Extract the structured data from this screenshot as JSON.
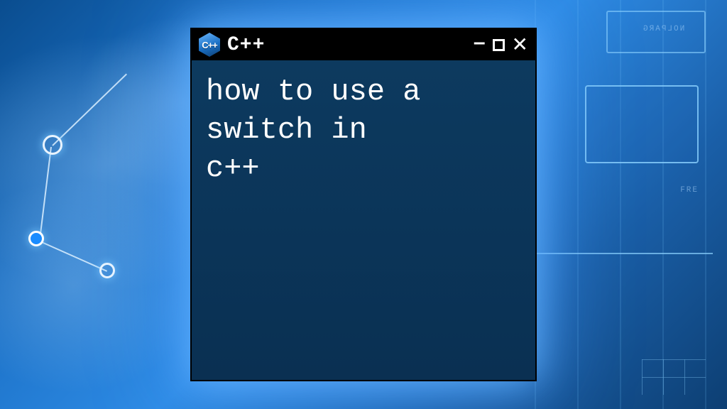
{
  "window": {
    "title": "C++",
    "icon_label": "C++",
    "icon_name": "cpp-hexagon-icon"
  },
  "body": {
    "text": "how to use a\nswitch in\nc++"
  },
  "controls": {
    "minimize": "–",
    "close": "✕"
  },
  "bg_labels": {
    "label2": "FRE",
    "label3": "NOLPARG"
  },
  "colors": {
    "window_body": "#0b3559",
    "titlebar": "#000000",
    "accent_blue": "#1a8cff"
  }
}
